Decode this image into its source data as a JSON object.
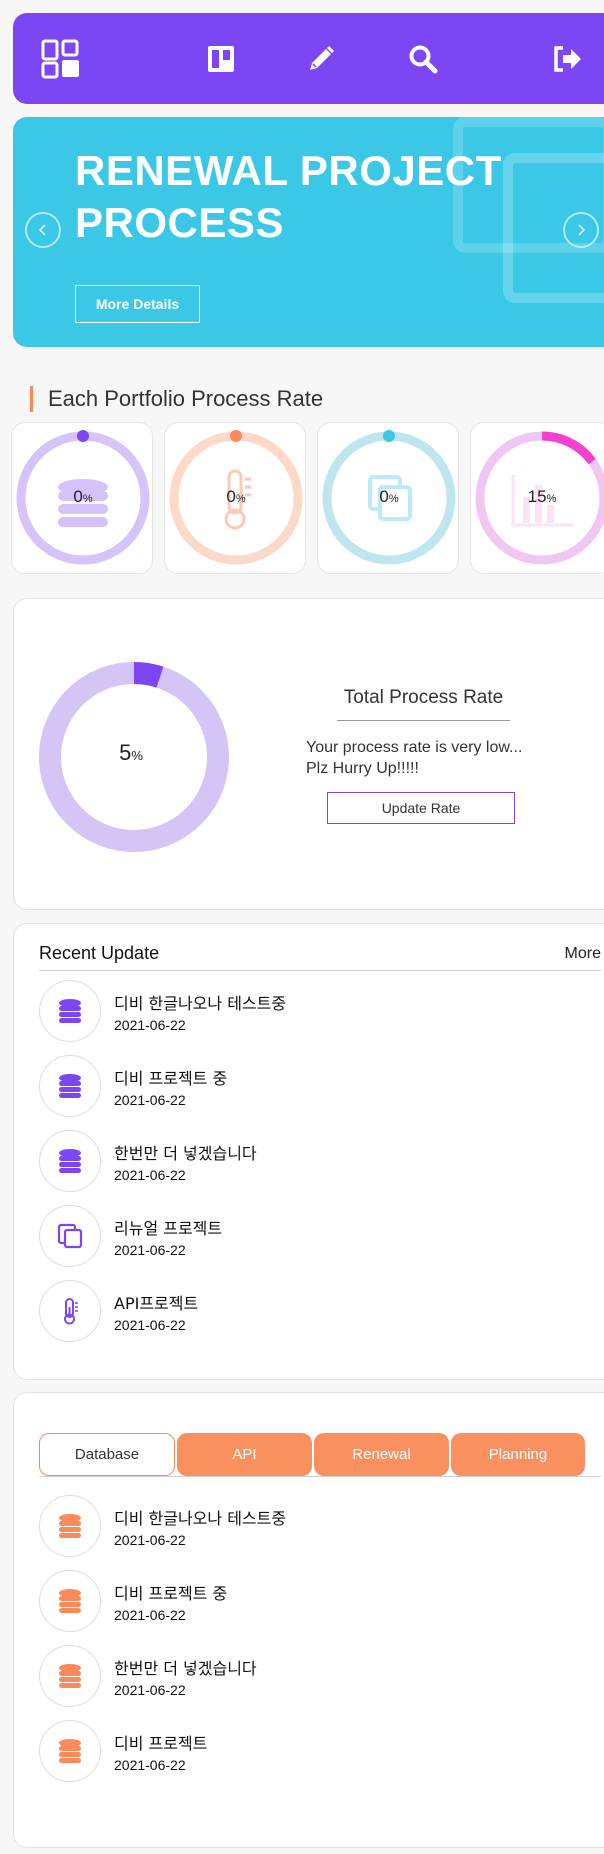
{
  "colors": {
    "purple": "#7c46f5",
    "cyan": "#3bc8e7",
    "orange": "#fa8a5c",
    "pink": "#f43fd0"
  },
  "nav": {
    "icons": [
      "dashboard-icon",
      "board-icon",
      "pencil-icon",
      "search-icon",
      "logout-icon"
    ]
  },
  "hero": {
    "title": "RENEWAL PROJECT PROCESS",
    "button": "More Details"
  },
  "portfolio": {
    "section_title": "Each Portfolio Process Rate",
    "unit": "%",
    "items": [
      {
        "icon": "database-icon",
        "value": "0",
        "rate": 0,
        "color": "#7c46f5"
      },
      {
        "icon": "thermometer-icon",
        "value": "0",
        "rate": 0,
        "color": "#fa8a5c"
      },
      {
        "icon": "copy-icon",
        "value": "0",
        "rate": 0,
        "color": "#3bc8e7"
      },
      {
        "icon": "bar-chart-icon",
        "value": "15",
        "rate": 0.15,
        "color": "#f43fd0"
      }
    ]
  },
  "total": {
    "value": "5",
    "rate": 0.05,
    "unit": "%",
    "title": "Total Process Rate",
    "message_line1": "Your process rate is very low...",
    "message_line2": "Plz Hurry Up!!!!!",
    "button": "Update Rate"
  },
  "recent": {
    "title": "Recent Update",
    "more": "More",
    "items": [
      {
        "icon": "database-icon",
        "title": "디비 한글나오나 테스트중",
        "date": "2021-06-22"
      },
      {
        "icon": "database-icon",
        "title": "디비 프로젝트 중",
        "date": "2021-06-22"
      },
      {
        "icon": "database-icon",
        "title": "한번만 더 넣겠습니다",
        "date": "2021-06-22"
      },
      {
        "icon": "copy-icon",
        "title": "리뉴얼 프로젝트",
        "date": "2021-06-22"
      },
      {
        "icon": "thermometer-icon",
        "title": "API프로젝트",
        "date": "2021-06-22"
      }
    ]
  },
  "categories": {
    "tabs": [
      "Database",
      "API",
      "Renewal",
      "Planning"
    ],
    "active_tab": "Database",
    "items": [
      {
        "icon": "database-icon",
        "title": "디비 한글나오나 테스트중",
        "date": "2021-06-22"
      },
      {
        "icon": "database-icon",
        "title": "디비 프로젝트 중",
        "date": "2021-06-22"
      },
      {
        "icon": "database-icon",
        "title": "한번만 더 넣겠습니다",
        "date": "2021-06-22"
      },
      {
        "icon": "database-icon",
        "title": "디비 프로젝트",
        "date": "2021-06-22"
      }
    ]
  }
}
